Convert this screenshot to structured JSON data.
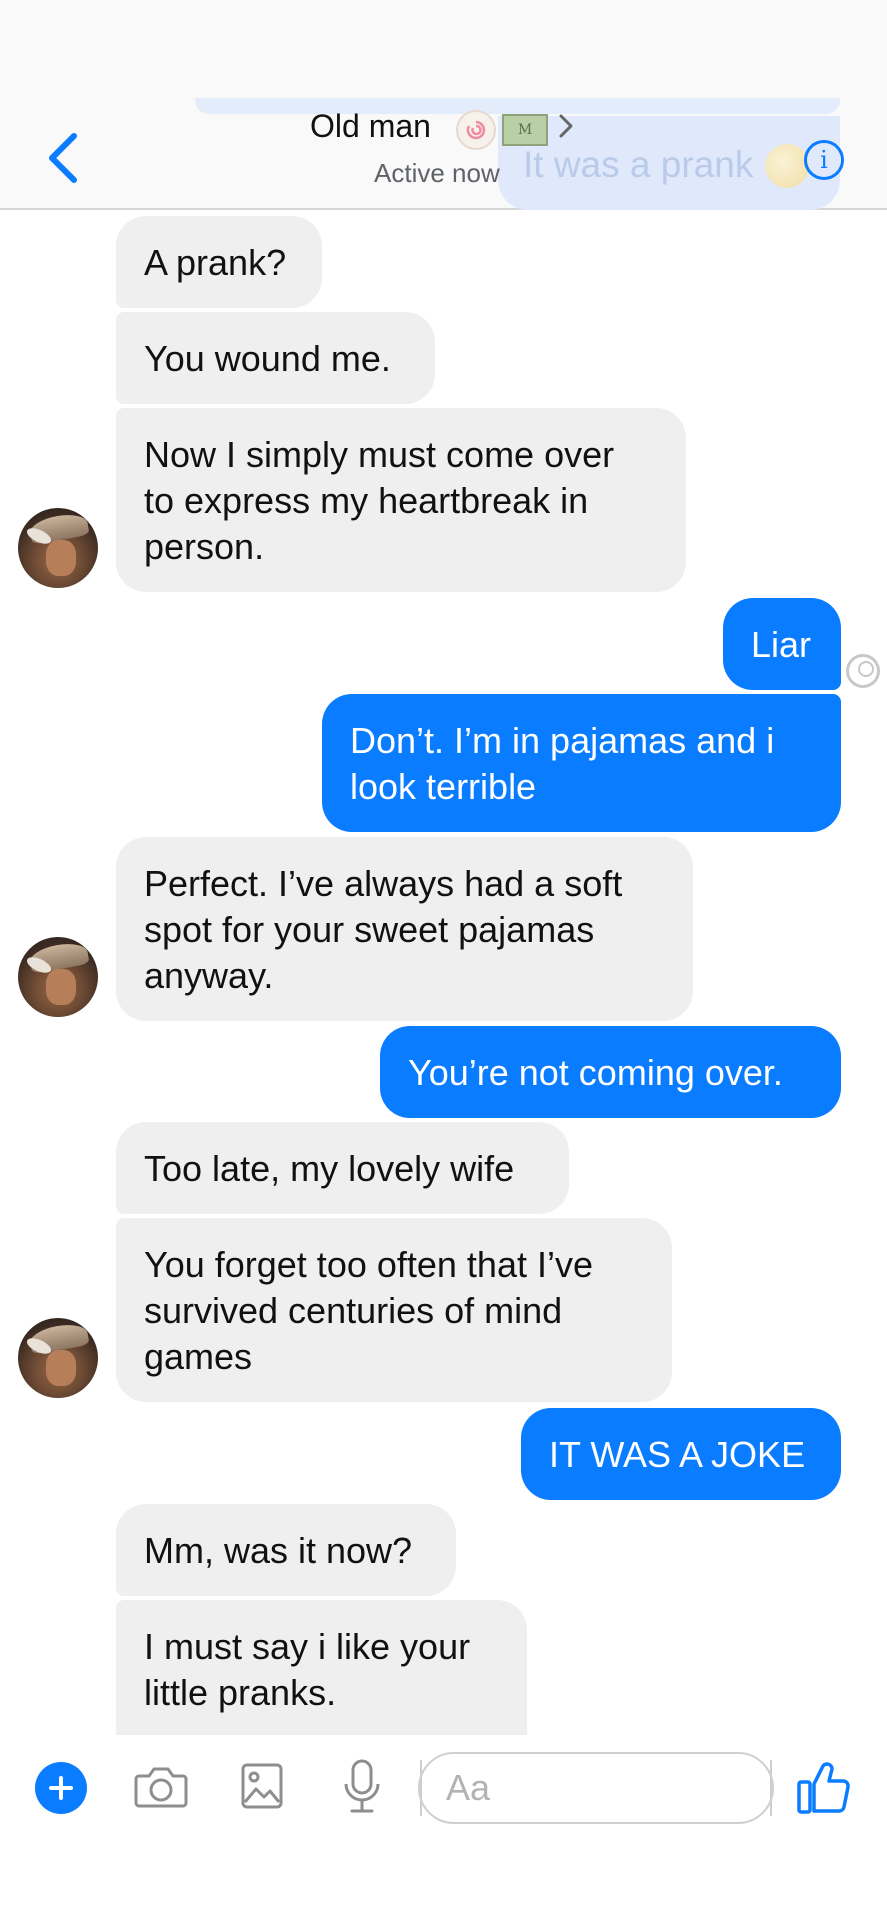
{
  "header": {
    "contact_name": "Old man",
    "status": "Active now",
    "name_emoji_1": "🍥",
    "name_emoji_2": "💵",
    "ghost_message": "It was a prank",
    "ghost_emoji": "😘"
  },
  "messages": [
    {
      "side": "in",
      "text": "A prank?"
    },
    {
      "side": "in",
      "text": "You wound me."
    },
    {
      "side": "in",
      "text": "Now I simply must come over\nto express my heartbreak in\nperson."
    },
    {
      "side": "out",
      "text": "Liar"
    },
    {
      "side": "out",
      "text": "Don’t. I’m in pajamas and i\nlook terrible"
    },
    {
      "side": "in",
      "text": "Perfect. I’ve always had a soft\nspot for your sweet pajamas\nanyway."
    },
    {
      "side": "out",
      "text": "You’re not coming over."
    },
    {
      "side": "in",
      "text": "Too late, my lovely wife"
    },
    {
      "side": "in",
      "text": "You forget too often that I’ve\nsurvived centuries of mind\ngames"
    },
    {
      "side": "out",
      "text": "IT WAS A JOKE"
    },
    {
      "side": "in",
      "text": "Mm, was it now?"
    },
    {
      "side": "in",
      "text": "I must say i like your\nlittle pranks."
    }
  ],
  "composer": {
    "placeholder": "Aa"
  },
  "colors": {
    "accent": "#0a7cff",
    "incoming_bubble": "#efefef",
    "outgoing_bubble": "#0a7cff"
  },
  "icons": [
    "back-chevron-icon",
    "info-icon",
    "plus-icon",
    "camera-icon",
    "image-icon",
    "microphone-icon",
    "thumbs-up-icon"
  ]
}
